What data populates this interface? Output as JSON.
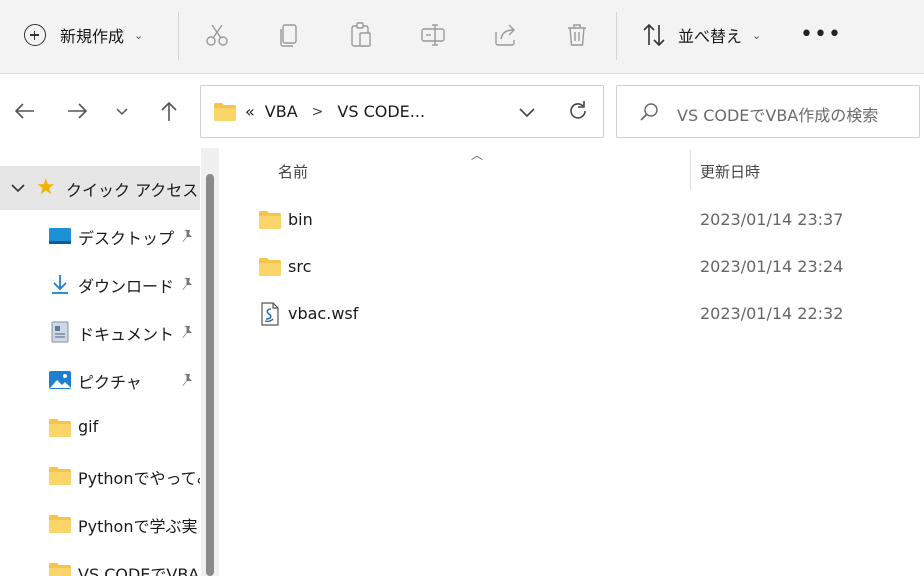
{
  "toolbar": {
    "new_label": "新規作成",
    "sort_label": "並べ替え",
    "more_label": "•••",
    "icons": [
      "cut-icon",
      "copy-icon",
      "paste-icon",
      "rename-icon",
      "share-icon",
      "delete-icon"
    ]
  },
  "nav": {
    "breadcrumb_overflow": "«",
    "breadcrumbs": [
      "VBA",
      "VS CODE..."
    ],
    "breadcrumb_separator": ">",
    "search_placeholder": "VS CODEでVBA作成の検索"
  },
  "sidebar": {
    "quick_access": "クイック アクセス",
    "items": [
      {
        "label": "デスクトップ",
        "icon": "desktop-icon",
        "pinned": true
      },
      {
        "label": "ダウンロード",
        "icon": "download-icon",
        "pinned": true
      },
      {
        "label": "ドキュメント",
        "icon": "document-icon",
        "pinned": true
      },
      {
        "label": "ピクチャ",
        "icon": "pictures-icon",
        "pinned": true
      },
      {
        "label": "gif",
        "icon": "folder-icon",
        "pinned": false
      },
      {
        "label": "Pythonでやってみ",
        "icon": "folder-icon",
        "pinned": false
      },
      {
        "label": "Pythonで学ぶ実",
        "icon": "folder-icon",
        "pinned": false
      },
      {
        "label": "VS CODEでVBA",
        "icon": "folder-icon",
        "pinned": false
      }
    ]
  },
  "file_list": {
    "columns": {
      "name": "名前",
      "modified": "更新日時"
    },
    "files": [
      {
        "name": "bin",
        "modified": "2023/01/14 23:37",
        "type": "folder"
      },
      {
        "name": "src",
        "modified": "2023/01/14 23:24",
        "type": "folder"
      },
      {
        "name": "vbac.wsf",
        "modified": "2023/01/14 22:32",
        "type": "script"
      }
    ]
  },
  "colors": {
    "folder": "#f6c44a",
    "star": "#f0b400",
    "selected_bg": "#e6e6e6",
    "toolbar_bg": "#f3f3f3"
  }
}
